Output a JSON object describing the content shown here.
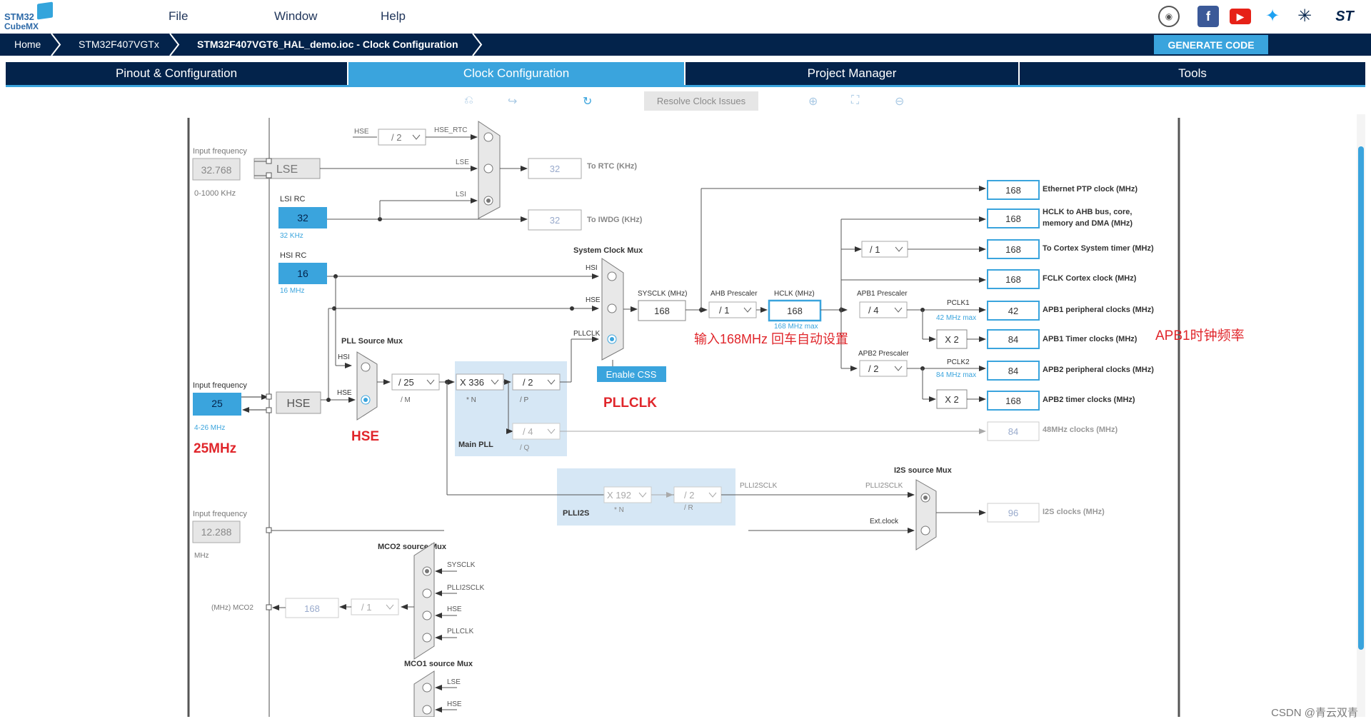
{
  "app": {
    "logo_line1": "STM32",
    "logo_line2": "CubeMX"
  },
  "menu": {
    "file": "File",
    "window": "Window",
    "help": "Help"
  },
  "breadcrumbs": [
    "Home",
    "STM32F407VGTx",
    "STM32F407VGT6_HAL_demo.ioc - Clock Configuration"
  ],
  "generate_code": "GENERATE CODE",
  "tabs": [
    "Pinout & Configuration",
    "Clock Configuration",
    "Project Manager",
    "Tools"
  ],
  "toolbar": {
    "resolve": "Resolve Clock Issues"
  },
  "colors": {
    "navy": "#03234b",
    "accent": "#3aa4dd",
    "annotation_red": "#e0262b"
  },
  "clock": {
    "lse_input_label": "Input frequency",
    "lse_input_value": "32.768",
    "lse_range": "0-1000 KHz",
    "lse": "LSE",
    "lsi_rc": "LSI RC",
    "lsi_value": "32",
    "lsi_unit": "32 KHz",
    "hsi_rc": "HSI RC",
    "hsi_value": "16",
    "hsi_unit": "16 MHz",
    "hse_input_label": "Input frequency",
    "hse_input_value": "25",
    "hse_range": "4-26 MHz",
    "hse": "HSE",
    "i2s_input_label": "Input frequency",
    "i2s_input_value": "12.288",
    "i2s_unit": "MHz",
    "hse_rtc_label": "HSE",
    "hse_rtc_div": "/ 2",
    "hse_rtc": "HSE_RTC",
    "lse_mux_label": "LSE",
    "lsi_mux_label": "LSI",
    "rtc_value": "32",
    "rtc_label": "To RTC (KHz)",
    "iwdg_value": "32",
    "iwdg_label": "To IWDG (KHz)",
    "sys_clock_mux": "System Clock Mux",
    "mux_hsi": "HSI",
    "mux_hse": "HSE",
    "mux_pllclk": "PLLCLK",
    "enable_css": "Enable CSS",
    "pll_source_mux": "PLL Source Mux",
    "pll_hsi": "HSI",
    "pll_hse": "HSE",
    "pll_m": "/ 25",
    "pll_m_label": "/ M",
    "pll_n": "X 336",
    "pll_n_label": "* N",
    "pll_p": "/ 2",
    "pll_p_label": "/ P",
    "pll_q": "/ 4",
    "pll_q_label": "/ Q",
    "main_pll": "Main PLL",
    "sysclk_label": "SYSCLK (MHz)",
    "sysclk": "168",
    "ahb_label": "AHB Prescaler",
    "ahb": "/ 1",
    "hclk_label": "HCLK (MHz)",
    "hclk": "168",
    "hclk_max": "168 MHz max",
    "apb1_label": "APB1 Prescaler",
    "apb1": "/ 4",
    "pclk1": "PCLK1",
    "pclk1_max": "42 MHz max",
    "apb2_label": "APB2 Prescaler",
    "apb2": "/ 2",
    "pclk2": "PCLK2",
    "pclk2_max": "84 MHz max",
    "cortex_div": "/ 1",
    "x2_a": "X 2",
    "x2_b": "X 2",
    "out_eth": "168",
    "out_eth_label": "Ethernet PTP clock (MHz)",
    "out_hclk": "168",
    "out_hclk_label": "HCLK to AHB bus, core,",
    "out_hclk_label2": "memory and DMA (MHz)",
    "out_cortex": "168",
    "out_cortex_label": "To Cortex System timer (MHz)",
    "out_fclk": "168",
    "out_fclk_label": "FCLK Cortex clock (MHz)",
    "out_apb1p": "42",
    "out_apb1p_label": "APB1 peripheral clocks (MHz)",
    "out_apb1t": "84",
    "out_apb1t_label": "APB1 Timer clocks (MHz)",
    "out_apb2p": "84",
    "out_apb2p_label": "APB2 peripheral clocks (MHz)",
    "out_apb2t": "168",
    "out_apb2t_label": "APB2 timer clocks (MHz)",
    "out_48": "84",
    "out_48_label": "48MHz clocks (MHz)",
    "plli2s": "PLLI2S",
    "plli2s_n": "X 192",
    "plli2s_n_label": "* N",
    "plli2s_r": "/ 2",
    "plli2s_r_label": "/ R",
    "plli2sclk": "PLLI2SCLK",
    "i2s_mux": "I2S source Mux",
    "i2s_mux_in1": "PLLI2SCLK",
    "ext_clock": "Ext.clock",
    "out_i2s": "96",
    "out_i2s_label": "I2S clocks (MHz)",
    "mco2_mux": "MCO2 source Mux",
    "mco2_opts": [
      "SYSCLK",
      "PLLI2SCLK",
      "HSE",
      "PLLCLK"
    ],
    "mco2_value": "168",
    "mco2_div": "/ 1",
    "mco2_label": "(MHz) MCO2",
    "mco1_mux": "MCO1 source Mux",
    "mco1_opts": [
      "LSE",
      "HSE"
    ]
  },
  "annotations": {
    "a_25mhz": "25MHz",
    "a_hse": "HSE",
    "a_pllclk": "PLLCLK",
    "a_input": "输入168MHz  回车自动设置",
    "a_apb1": "APB1时钟频率"
  },
  "watermark": "CSDN @青云双青"
}
